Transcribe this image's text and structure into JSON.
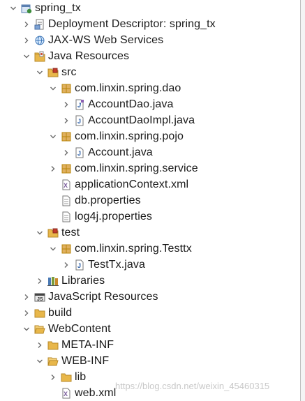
{
  "tree": {
    "nodes": [
      {
        "label": "spring_tx",
        "depth": 0,
        "toggle": "expanded",
        "icon": "web-project-icon",
        "name": "project-spring-tx"
      },
      {
        "label": "Deployment Descriptor: spring_tx",
        "depth": 1,
        "toggle": "collapsed",
        "icon": "deployment-descriptor-icon",
        "name": "deployment-descriptor"
      },
      {
        "label": "JAX-WS Web Services",
        "depth": 1,
        "toggle": "collapsed",
        "icon": "web-services-icon",
        "name": "jax-ws-web-services"
      },
      {
        "label": "Java Resources",
        "depth": 1,
        "toggle": "expanded",
        "icon": "java-resources-icon",
        "name": "java-resources"
      },
      {
        "label": "src",
        "depth": 2,
        "toggle": "expanded",
        "icon": "source-folder-icon",
        "name": "src-folder"
      },
      {
        "label": "com.linxin.spring.dao",
        "depth": 3,
        "toggle": "expanded",
        "icon": "package-icon",
        "name": "package-dao"
      },
      {
        "label": "AccountDao.java",
        "depth": 4,
        "toggle": "collapsed",
        "icon": "java-interface-file-icon",
        "name": "file-accountdao-java"
      },
      {
        "label": "AccountDaoImpl.java",
        "depth": 4,
        "toggle": "collapsed",
        "icon": "java-file-icon",
        "name": "file-accountdaoimpl-java"
      },
      {
        "label": "com.linxin.spring.pojo",
        "depth": 3,
        "toggle": "expanded",
        "icon": "package-icon",
        "name": "package-pojo"
      },
      {
        "label": "Account.java",
        "depth": 4,
        "toggle": "collapsed",
        "icon": "java-file-icon",
        "name": "file-account-java"
      },
      {
        "label": "com.linxin.spring.service",
        "depth": 3,
        "toggle": "collapsed",
        "icon": "package-icon",
        "name": "package-service"
      },
      {
        "label": "applicationContext.xml",
        "depth": 3,
        "toggle": "none",
        "icon": "xml-file-icon",
        "name": "file-applicationcontext-xml"
      },
      {
        "label": "db.properties",
        "depth": 3,
        "toggle": "none",
        "icon": "text-file-icon",
        "name": "file-db-properties"
      },
      {
        "label": "log4j.properties",
        "depth": 3,
        "toggle": "none",
        "icon": "text-file-icon",
        "name": "file-log4j-properties"
      },
      {
        "label": "test",
        "depth": 2,
        "toggle": "expanded",
        "icon": "source-folder-icon",
        "name": "test-folder"
      },
      {
        "label": "com.linxin.spring.Testtx",
        "depth": 3,
        "toggle": "expanded",
        "icon": "package-icon",
        "name": "package-testtx"
      },
      {
        "label": "TestTx.java",
        "depth": 4,
        "toggle": "collapsed",
        "icon": "java-file-icon",
        "name": "file-testtx-java"
      },
      {
        "label": "Libraries",
        "depth": 2,
        "toggle": "collapsed",
        "icon": "libraries-icon",
        "name": "libraries"
      },
      {
        "label": "JavaScript Resources",
        "depth": 1,
        "toggle": "collapsed",
        "icon": "javascript-resources-icon",
        "name": "javascript-resources"
      },
      {
        "label": "build",
        "depth": 1,
        "toggle": "collapsed",
        "icon": "folder-icon",
        "name": "build-folder"
      },
      {
        "label": "WebContent",
        "depth": 1,
        "toggle": "expanded",
        "icon": "folder-open-icon",
        "name": "webcontent-folder"
      },
      {
        "label": "META-INF",
        "depth": 2,
        "toggle": "collapsed",
        "icon": "folder-icon",
        "name": "meta-inf-folder"
      },
      {
        "label": "WEB-INF",
        "depth": 2,
        "toggle": "expanded",
        "icon": "folder-open-icon",
        "name": "web-inf-folder"
      },
      {
        "label": "lib",
        "depth": 3,
        "toggle": "collapsed",
        "icon": "folder-icon",
        "name": "lib-folder"
      },
      {
        "label": "web.xml",
        "depth": 3,
        "toggle": "none",
        "icon": "xml-file-icon",
        "name": "file-web-xml"
      }
    ]
  },
  "watermark": "https://blog.csdn.net/weixin_45460315",
  "colors": {
    "toggle_arrow": "#6b6b6b",
    "package": "#b8860b",
    "folder": "#e8b74a",
    "java_file": "#2c5fa8",
    "xml": "#7a5c9b"
  }
}
